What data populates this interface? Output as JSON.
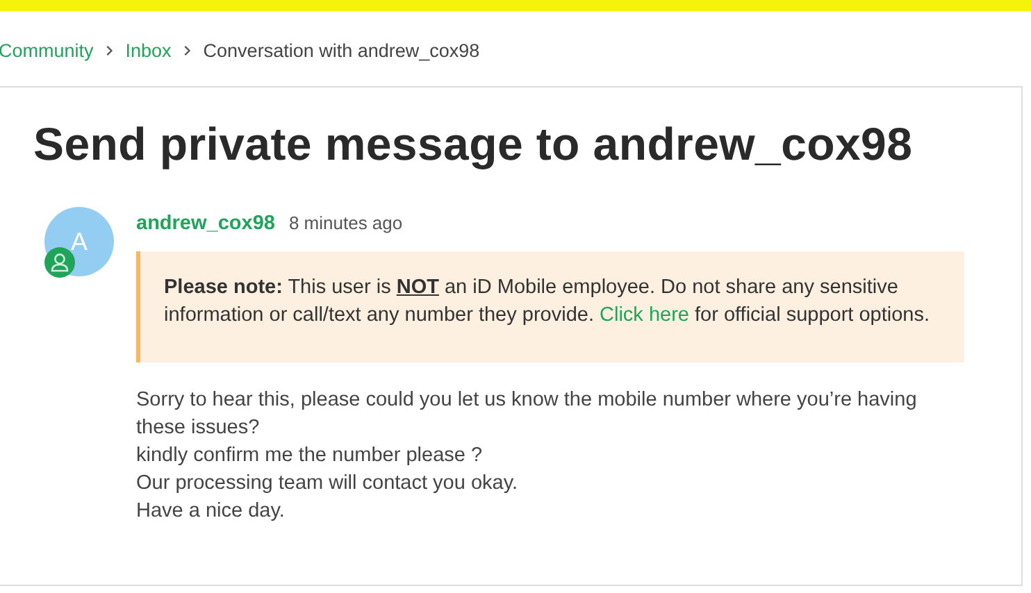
{
  "breadcrumb": [
    {
      "label": "Community",
      "link": true
    },
    {
      "label": "Inbox",
      "link": true
    },
    {
      "label": "Conversation with andrew_cox98",
      "link": false
    }
  ],
  "title": "Send private message to andrew_cox98",
  "message": {
    "avatar_letter": "A",
    "author": "andrew_cox98",
    "time": "8 minutes ago",
    "note": {
      "label": "Please note:",
      "before": " This user is ",
      "emphasis": "NOT",
      "middle": " an iD Mobile employee. Do not share any sensitive information or call/text any number they provide. ",
      "link": "Click here",
      "after": " for official support options."
    },
    "body": [
      "Sorry to hear this, please could you let us know the mobile number where you’re having these issues?",
      "kindly confirm me the number please ?",
      "Our processing team will contact you okay.",
      "Have a nice day."
    ]
  }
}
